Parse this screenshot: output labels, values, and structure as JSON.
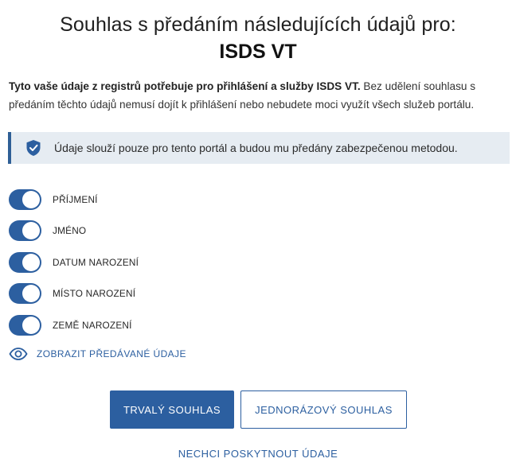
{
  "heading": {
    "line1": "Souhlas s předáním následujících údajů pro:",
    "service": "ISDS VT"
  },
  "intro": {
    "bold": "Tyto vaše údaje z registrů potřebuje pro přihlášení a služby ISDS VT.",
    "text": " Bez udělení souhlasu s předáním těchto údajů nemusí dojít k přihlášení nebo nebudete moci využít všech služeb portálu."
  },
  "notice": {
    "icon": "shield-check-icon",
    "text": "Údaje slouží pouze pro tento portál a budou mu předány zabezpečenou metodou."
  },
  "toggles": [
    {
      "label": "PŘÍJMENÍ",
      "on": true
    },
    {
      "label": "JMÉNO",
      "on": true
    },
    {
      "label": "DATUM NAROZENÍ",
      "on": true
    },
    {
      "label": "MÍSTO NAROZENÍ",
      "on": true
    },
    {
      "label": "ZEMĚ NAROZENÍ",
      "on": true
    }
  ],
  "show_data": {
    "icon": "eye-icon",
    "label": "ZOBRAZIT PŘEDÁVANÉ ÚDAJE"
  },
  "buttons": {
    "permanent": "TRVALÝ SOUHLAS",
    "one_time": "JEDNORÁZOVÝ SOUHLAS",
    "decline": "NECHCI POSKYTNOUT ÚDAJE"
  },
  "colors": {
    "accent": "#2c5fa0",
    "notice_bg": "#e6ecf2",
    "text": "#262626"
  }
}
